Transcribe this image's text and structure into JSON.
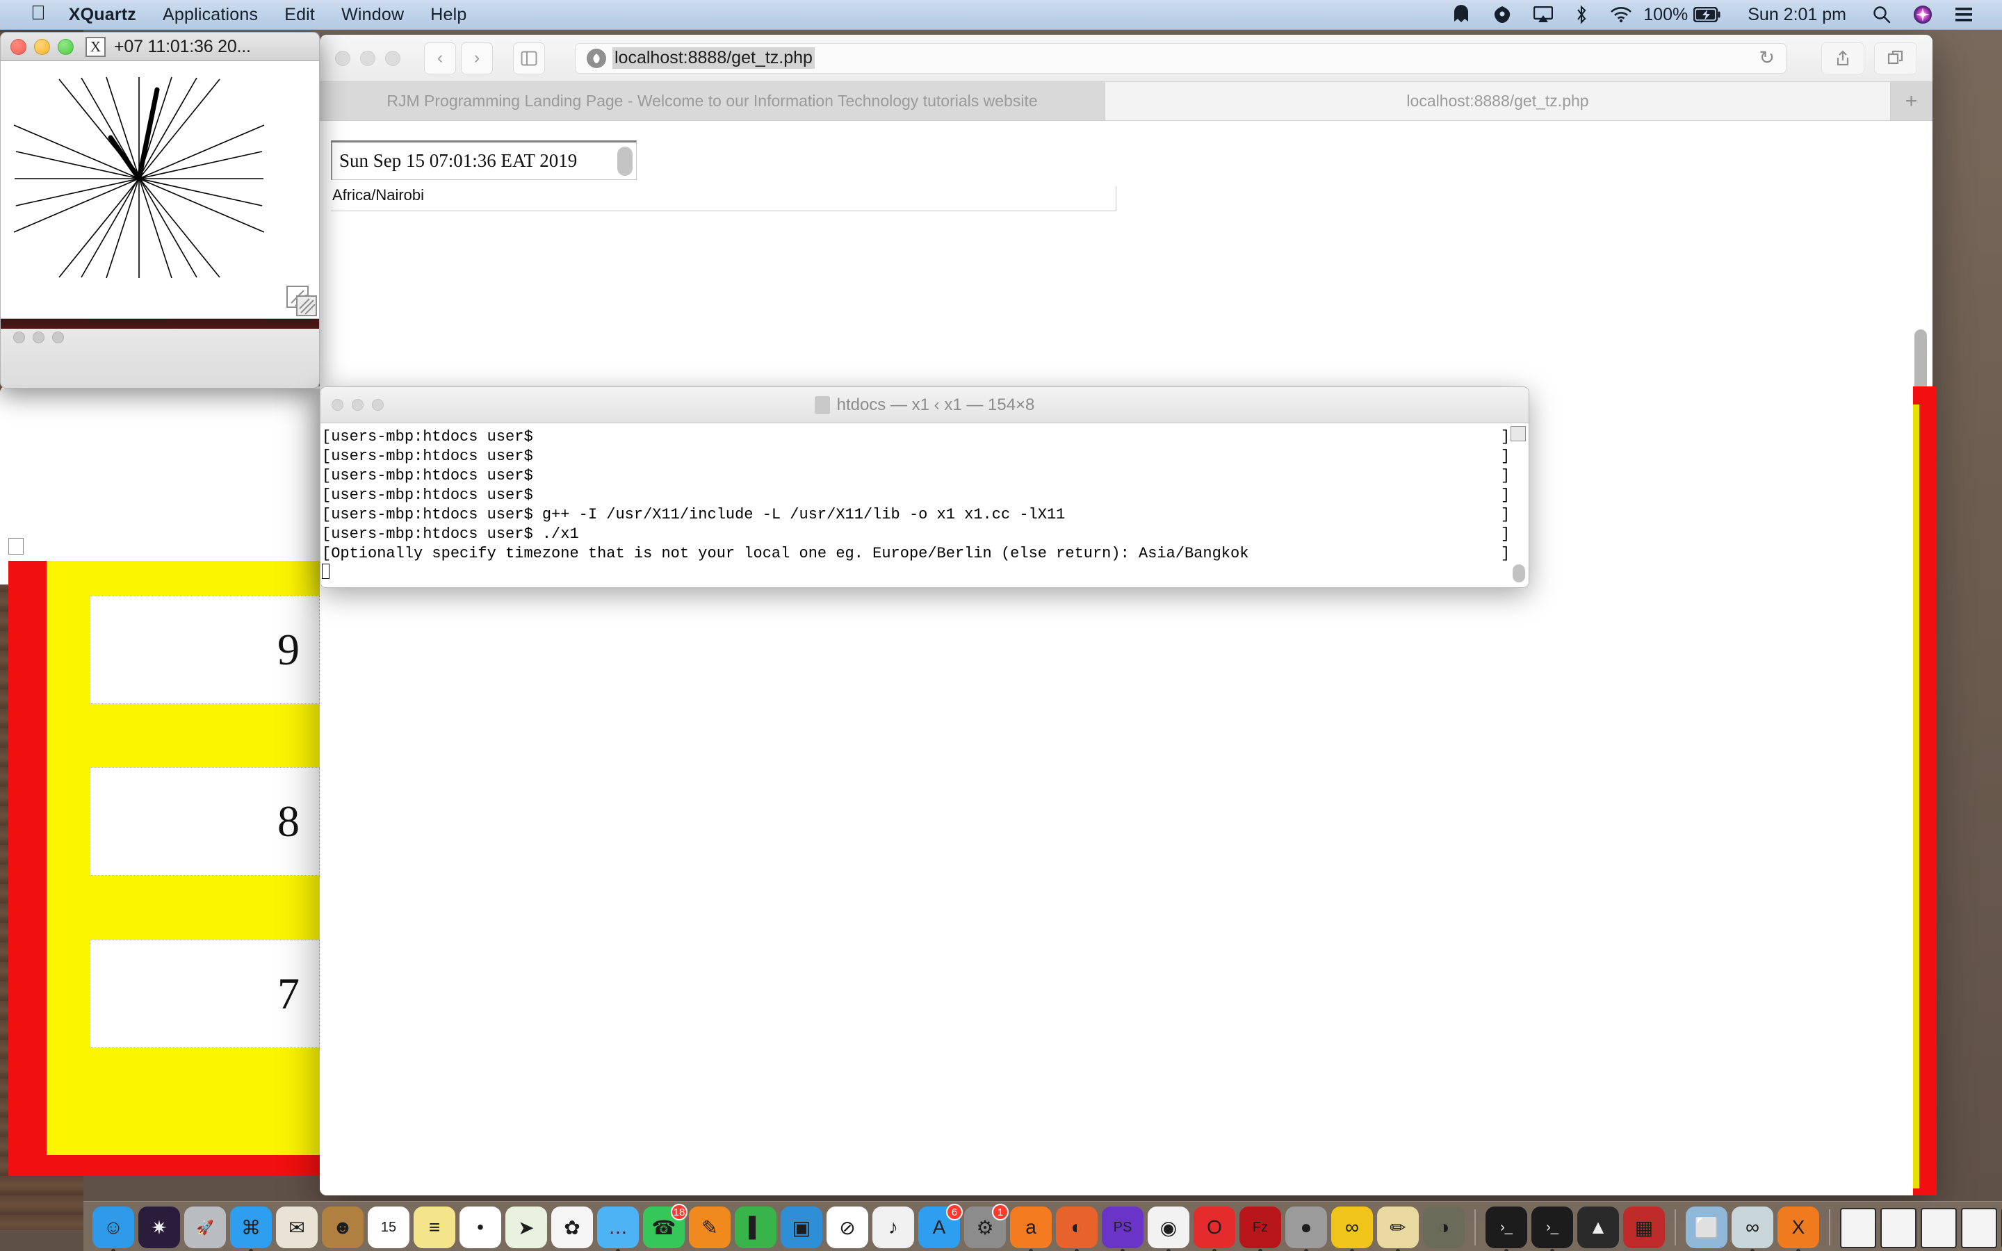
{
  "menubar": {
    "apple": "apple-logo",
    "items": [
      {
        "label": "XQuartz",
        "bold": true
      },
      {
        "label": "Applications",
        "bold": false
      },
      {
        "label": "Edit",
        "bold": false
      },
      {
        "label": "Window",
        "bold": false
      },
      {
        "label": "Help",
        "bold": false
      }
    ],
    "status": {
      "battery_percent": "100%",
      "clock": "Sun 2:01 pm",
      "icons": [
        "malwarebytes-icon",
        "bartender-icon",
        "airplay-icon",
        "bluetooth-icon",
        "wifi-icon",
        "battery-charging-icon",
        "spotlight-search-icon",
        "siri-icon",
        "notification-center-icon"
      ]
    }
  },
  "xquartz_window": {
    "title": "+07 11:01:36 20...",
    "app_icon": "x11-icon",
    "traffic_lights": [
      "close-button",
      "minimize-button",
      "zoom-button"
    ],
    "canvas_name": "x11-clock-starburst"
  },
  "safari": {
    "toolbar": {
      "back_label": "‹",
      "forward_label": "›",
      "sidebar_icon": "sidebar-icon",
      "url": "localhost:8888/get_tz.php",
      "reload_icon": "reload-icon",
      "share_icon": "share-icon",
      "tabs_icon": "show-all-tabs-icon"
    },
    "tabs": [
      {
        "label": "RJM Programming Landing Page - Welcome to our Information Technology tutorials website",
        "active": true
      },
      {
        "label": "localhost:8888/get_tz.php",
        "active": false
      }
    ],
    "new_tab_label": "+",
    "page": {
      "date_value": "Sun Sep 15 07:01:36 EAT 2019",
      "timezone_value": "Africa/Nairobi"
    }
  },
  "red_page": {
    "numbers": [
      "9",
      "8",
      "7"
    ],
    "border_color": "#f20f0f",
    "fill_color": "#fbf500"
  },
  "terminal": {
    "title": "htdocs — x1 ‹ x1 — 154×8",
    "folder_icon": "folder-icon",
    "lines": [
      "[users-mbp:htdocs user$",
      "[users-mbp:htdocs user$",
      "[users-mbp:htdocs user$",
      "[users-mbp:htdocs user$",
      "[users-mbp:htdocs user$ g++ -I /usr/X11/include -L /usr/X11/lib -o x1 x1.cc -lX11",
      "[users-mbp:htdocs user$ ./x1",
      "[Optionally specify timezone that is not your local one eg. Europe/Berlin (else return): Asia/Bangkok"
    ],
    "right_brackets": [
      "]",
      "]",
      "]",
      "]",
      "]",
      "]",
      "]"
    ]
  },
  "dock": {
    "items": [
      {
        "name": "finder",
        "color": "#2f9ae8",
        "glyph": "☺",
        "running": true
      },
      {
        "name": "siri",
        "color": "#2a1d3c",
        "glyph": "✷",
        "running": false
      },
      {
        "name": "launchpad",
        "color": "#b9bcc0",
        "glyph": "🚀",
        "running": false
      },
      {
        "name": "safari",
        "color": "#2e9ef0",
        "glyph": "⌘",
        "running": true
      },
      {
        "name": "mail",
        "color": "#e8e3d5",
        "glyph": "✉",
        "running": false
      },
      {
        "name": "contacts",
        "color": "#b08040",
        "glyph": "☻",
        "running": false
      },
      {
        "name": "calendar",
        "color": "#ffffff",
        "glyph": "15",
        "running": false
      },
      {
        "name": "notes",
        "color": "#f5e58a",
        "glyph": "≡",
        "running": false
      },
      {
        "name": "reminders",
        "color": "#ffffff",
        "glyph": "•",
        "running": false
      },
      {
        "name": "maps",
        "color": "#e8f2de",
        "glyph": "➤",
        "running": false
      },
      {
        "name": "photos",
        "color": "#f5f5f5",
        "glyph": "✿",
        "running": false
      },
      {
        "name": "messages",
        "color": "#4eb3f5",
        "glyph": "…",
        "running": true
      },
      {
        "name": "facetime",
        "color": "#35c759",
        "glyph": "☎",
        "running": false,
        "badge": "18"
      },
      {
        "name": "pages",
        "color": "#f08a1e",
        "glyph": "✎",
        "running": false
      },
      {
        "name": "numbers",
        "color": "#38b44a",
        "glyph": "▌",
        "running": false
      },
      {
        "name": "keynote",
        "color": "#2e8fd6",
        "glyph": "▣",
        "running": false
      },
      {
        "name": "no-entry-app",
        "color": "#ffffff",
        "glyph": "⊘",
        "running": false
      },
      {
        "name": "itunes",
        "color": "#f0f0f0",
        "glyph": "♪",
        "running": false
      },
      {
        "name": "app-store",
        "color": "#2e9ef0",
        "glyph": "A",
        "running": false,
        "badge": "6"
      },
      {
        "name": "system-preferences",
        "color": "#8c8c8c",
        "glyph": "⚙",
        "running": false,
        "badge": "1"
      },
      {
        "name": "avast",
        "color": "#f47b20",
        "glyph": "a",
        "running": true
      },
      {
        "name": "firefox",
        "color": "#e8622c",
        "glyph": "◐",
        "running": true
      },
      {
        "name": "phpstorm",
        "color": "#6b34c8",
        "glyph": "PS",
        "running": true
      },
      {
        "name": "chrome",
        "color": "#f2f2f2",
        "glyph": "◉",
        "running": true
      },
      {
        "name": "opera",
        "color": "#e52b2b",
        "glyph": "O",
        "running": true
      },
      {
        "name": "filezilla",
        "color": "#b8161b",
        "glyph": "Fz",
        "running": true
      },
      {
        "name": "mamp",
        "color": "#9b9b9b",
        "glyph": "●",
        "running": true
      },
      {
        "name": "mamp-pro",
        "color": "#f0c419",
        "glyph": "∞",
        "running": true
      },
      {
        "name": "seashore",
        "color": "#e8d9a0",
        "glyph": "✏",
        "running": true
      },
      {
        "name": "gimp",
        "color": "#6b6b5a",
        "glyph": "◑",
        "running": false
      },
      {
        "name": "terminal",
        "color": "#1c1c1c",
        "glyph": "›_",
        "running": true
      },
      {
        "name": "iterm",
        "color": "#1c1c1c",
        "glyph": "›_",
        "running": true
      },
      {
        "name": "inkscape",
        "color": "#2a2a2a",
        "glyph": "▲",
        "running": false
      },
      {
        "name": "photo-booth",
        "color": "#c02a2a",
        "glyph": "▦",
        "running": false
      },
      {
        "name": "image-capture",
        "color": "#8fb7d8",
        "glyph": "⬜",
        "running": false
      },
      {
        "name": "arduino",
        "color": "#c9d6d9",
        "glyph": "∞",
        "running": true
      },
      {
        "name": "xquartz",
        "color": "#f07a1e",
        "glyph": "X",
        "running": true
      }
    ],
    "minimized": [
      {
        "name": "minimized-window-1"
      },
      {
        "name": "minimized-window-2"
      },
      {
        "name": "minimized-window-3"
      },
      {
        "name": "minimized-window-4"
      },
      {
        "name": "minimized-window-5"
      },
      {
        "name": "minimized-window-6"
      },
      {
        "name": "minimized-window-7"
      }
    ],
    "trash": {
      "name": "trash",
      "glyph": "□"
    }
  }
}
